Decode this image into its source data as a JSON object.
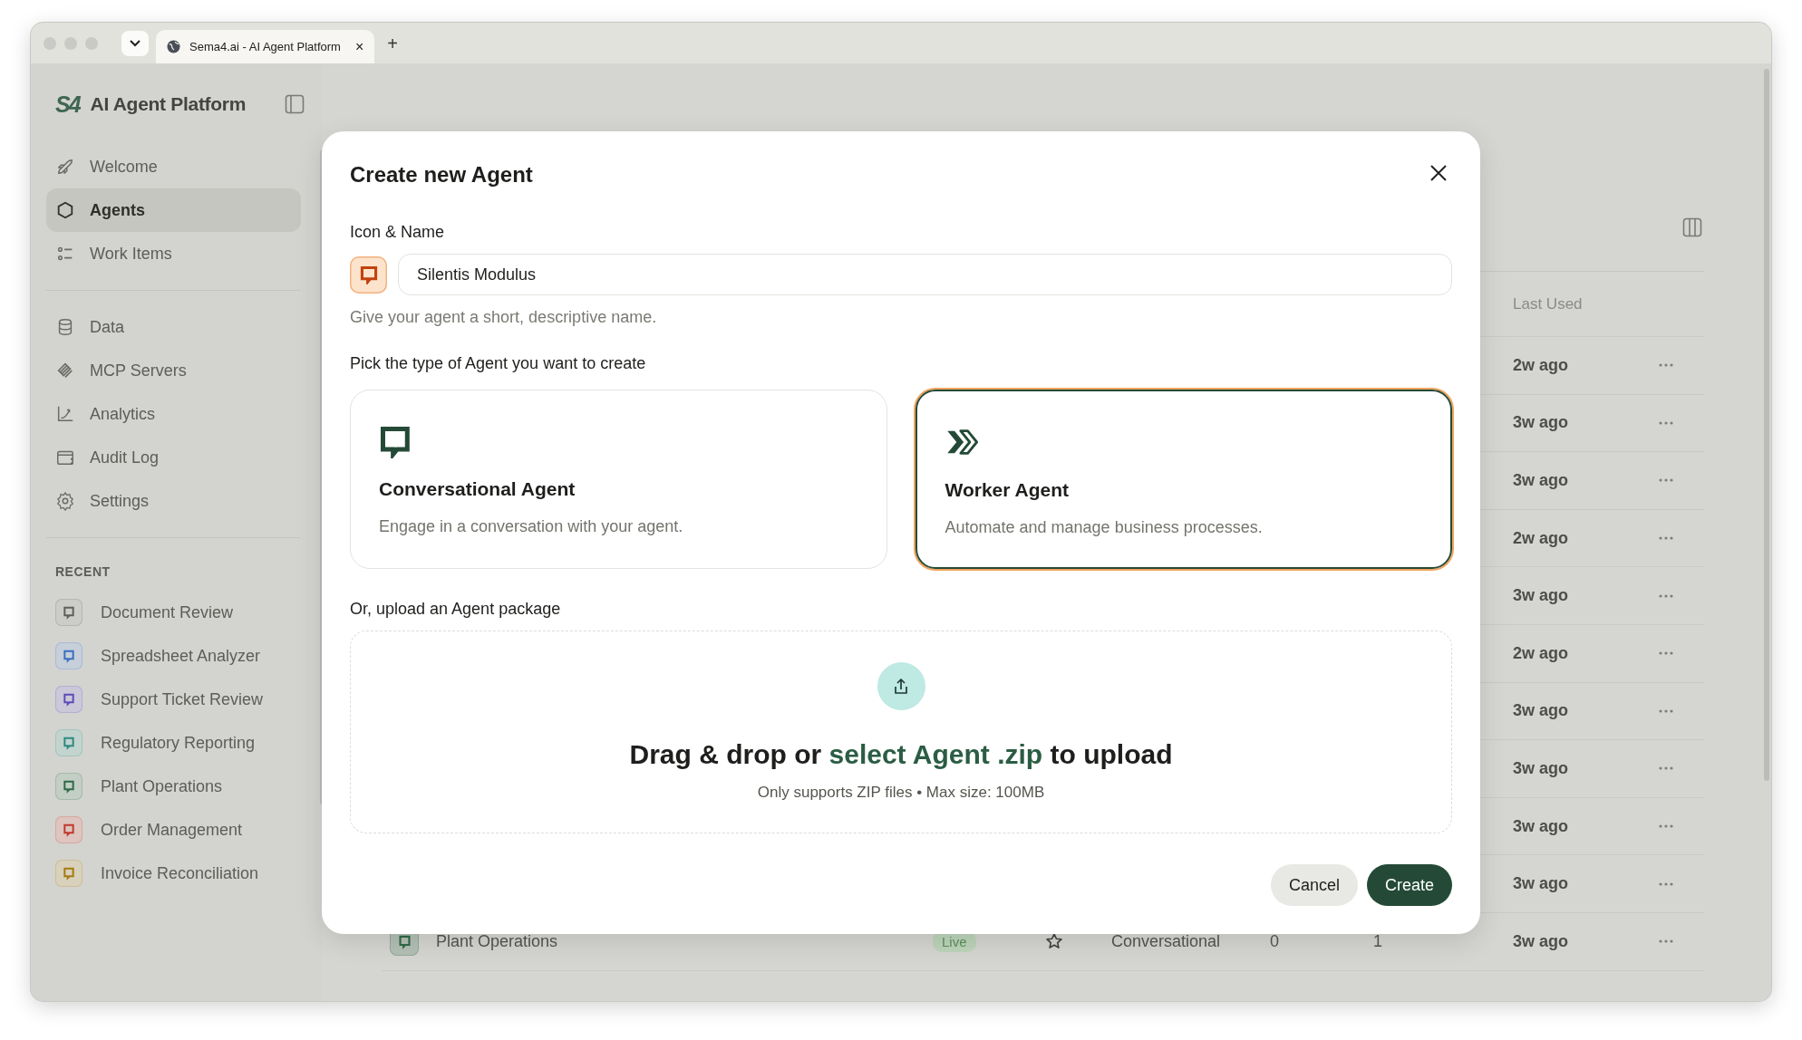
{
  "browser": {
    "tab_title": "Sema4.ai - AI Agent Platform",
    "tab_close": "×",
    "new_tab": "+"
  },
  "sidebar": {
    "logo": "S4",
    "title": "AI Agent Platform",
    "nav_groups": [
      {
        "items": [
          {
            "label": "Welcome",
            "selected": false
          },
          {
            "label": "Agents",
            "selected": true
          },
          {
            "label": "Work Items",
            "selected": false
          }
        ]
      },
      {
        "items": [
          {
            "label": "Data",
            "selected": false
          },
          {
            "label": "MCP Servers",
            "selected": false
          },
          {
            "label": "Analytics",
            "selected": false
          },
          {
            "label": "Audit Log",
            "selected": false
          },
          {
            "label": "Settings",
            "selected": false
          }
        ]
      }
    ],
    "recent_heading": "RECENT",
    "recent": [
      {
        "label": "Document Review",
        "color": "#5e5e5a"
      },
      {
        "label": "Spreadsheet Analyzer",
        "color": "#3b6fbf"
      },
      {
        "label": "Support Ticket Review",
        "color": "#5a4bb8"
      },
      {
        "label": "Regulatory Reporting",
        "color": "#2d8a80"
      },
      {
        "label": "Plant Operations",
        "color": "#2f6a47"
      },
      {
        "label": "Order Management",
        "color": "#c0392b"
      },
      {
        "label": "Invoice Reconciliation",
        "color": "#a47a12"
      }
    ]
  },
  "table": {
    "header": {
      "last_used": "Last Used"
    },
    "rows": [
      {
        "last_used": "2w ago"
      },
      {
        "last_used": "3w ago"
      },
      {
        "last_used": "3w ago"
      },
      {
        "last_used": "2w ago"
      },
      {
        "last_used": "3w ago"
      },
      {
        "last_used": "2w ago"
      },
      {
        "last_used": "3w ago"
      },
      {
        "last_used": "3w ago"
      },
      {
        "last_used": "3w ago"
      },
      {
        "last_used": "3w ago"
      },
      {
        "name": "Plant Operations",
        "color": "#2f6a47",
        "status": "Live",
        "starred": false,
        "type": "Conversational",
        "column_5": "0",
        "column_6": "1",
        "last_used": "3w ago"
      }
    ]
  },
  "dialog": {
    "title": "Create new Agent",
    "name_label": "Icon & Name",
    "name_value": "Silentis Modulus",
    "name_hint": "Give your agent a short, descriptive name.",
    "type_label": "Pick the type of Agent you want to create",
    "agent_types": [
      {
        "kind": "conversational",
        "title": "Conversational Agent",
        "description": "Engage in a conversation with your agent.",
        "selected": false
      },
      {
        "kind": "worker",
        "title": "Worker Agent",
        "description": "Automate and manage business processes.",
        "selected": true
      }
    ],
    "upload_label": "Or, upload an Agent package",
    "upload_prefix": "Drag & drop or",
    "upload_link": "select Agent .zip",
    "upload_suffix": "to upload",
    "upload_note": "Only supports ZIP files • Max size: 100MB",
    "buttons": [
      {
        "kind": "secondary",
        "label": "Cancel"
      },
      {
        "kind": "primary",
        "label": "Create"
      }
    ]
  }
}
